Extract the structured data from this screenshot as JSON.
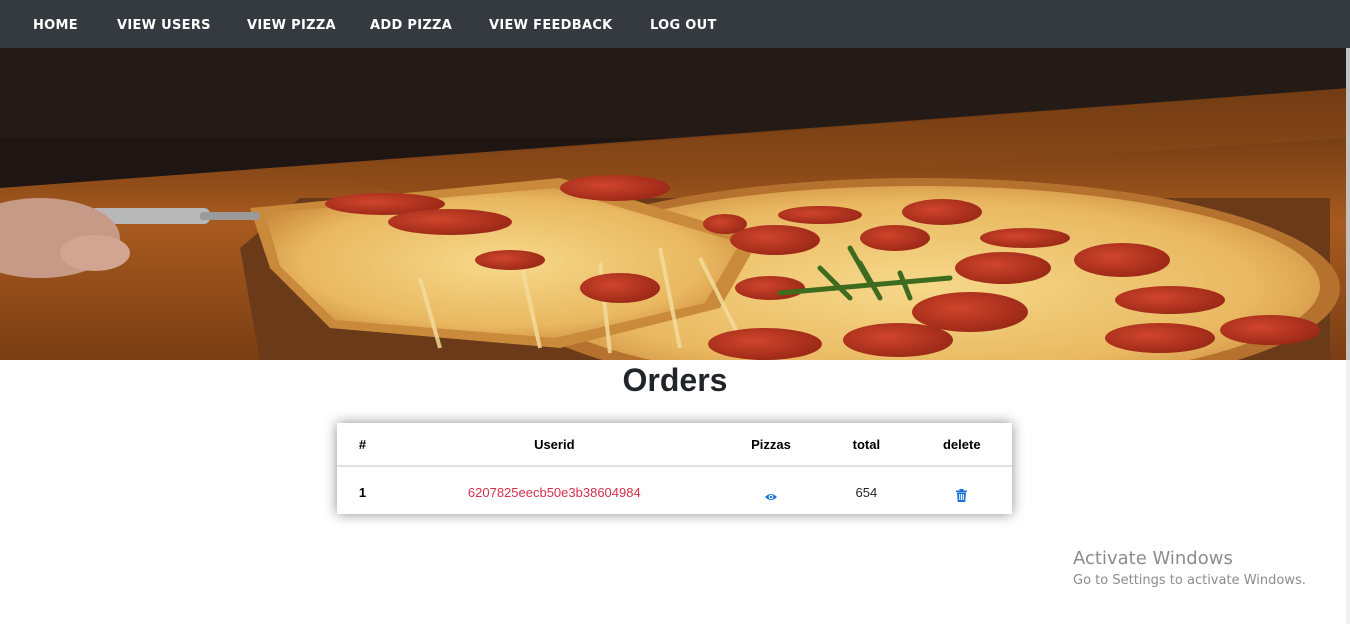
{
  "nav": {
    "items": [
      {
        "label": "HOME"
      },
      {
        "label": "VIEW USERS"
      },
      {
        "label": "VIEW PIZZA"
      },
      {
        "label": "ADD PIZZA"
      },
      {
        "label": "VIEW FEEDBACK"
      },
      {
        "label": "LOG OUT"
      }
    ]
  },
  "page": {
    "title": "Orders"
  },
  "orders_table": {
    "headers": [
      "#",
      "Userid",
      "Pizzas",
      "total",
      "delete"
    ],
    "rows": [
      {
        "num": "1",
        "userid": "6207825eecb50e3b38604984",
        "pizzas_icon": "eye-icon",
        "total": "654",
        "delete_icon": "trash-icon"
      }
    ]
  },
  "watermark": {
    "title": "Activate Windows",
    "subtitle": "Go to Settings to activate Windows."
  },
  "colors": {
    "navbar_bg": "#343a40",
    "link_red": "#d5304a",
    "icon_blue": "#1a73d9"
  }
}
